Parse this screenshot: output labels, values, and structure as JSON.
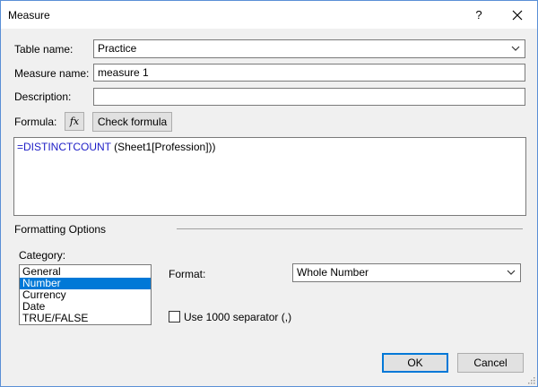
{
  "window": {
    "title": "Measure",
    "help_glyph": "?",
    "close_icon": "close-icon"
  },
  "labels": {
    "table_name": "Table name:",
    "measure_name": "Measure name:",
    "description": "Description:",
    "formula": "Formula:"
  },
  "fields": {
    "table_name_value": "Practice",
    "measure_name_value": "measure 1",
    "description_value": ""
  },
  "formula": {
    "fx_label": "fx",
    "check_button": "Check formula",
    "prefix": "=",
    "function": "DISTINCTCOUNT",
    "args": " (Sheet1[Profession]))"
  },
  "formatting": {
    "section_title": "Formatting Options",
    "category_label": "Category:",
    "categories": [
      "General",
      "Number",
      "Currency",
      "Date",
      "TRUE/FALSE"
    ],
    "selected_category": "Number",
    "format_label": "Format:",
    "format_value": "Whole Number",
    "separator_label": "Use 1000 separator (,)",
    "separator_checked": false
  },
  "buttons": {
    "ok": "OK",
    "cancel": "Cancel"
  },
  "colors": {
    "accent": "#0078d7",
    "keyword": "#1d1dc6",
    "border": "#5a8fd6"
  }
}
